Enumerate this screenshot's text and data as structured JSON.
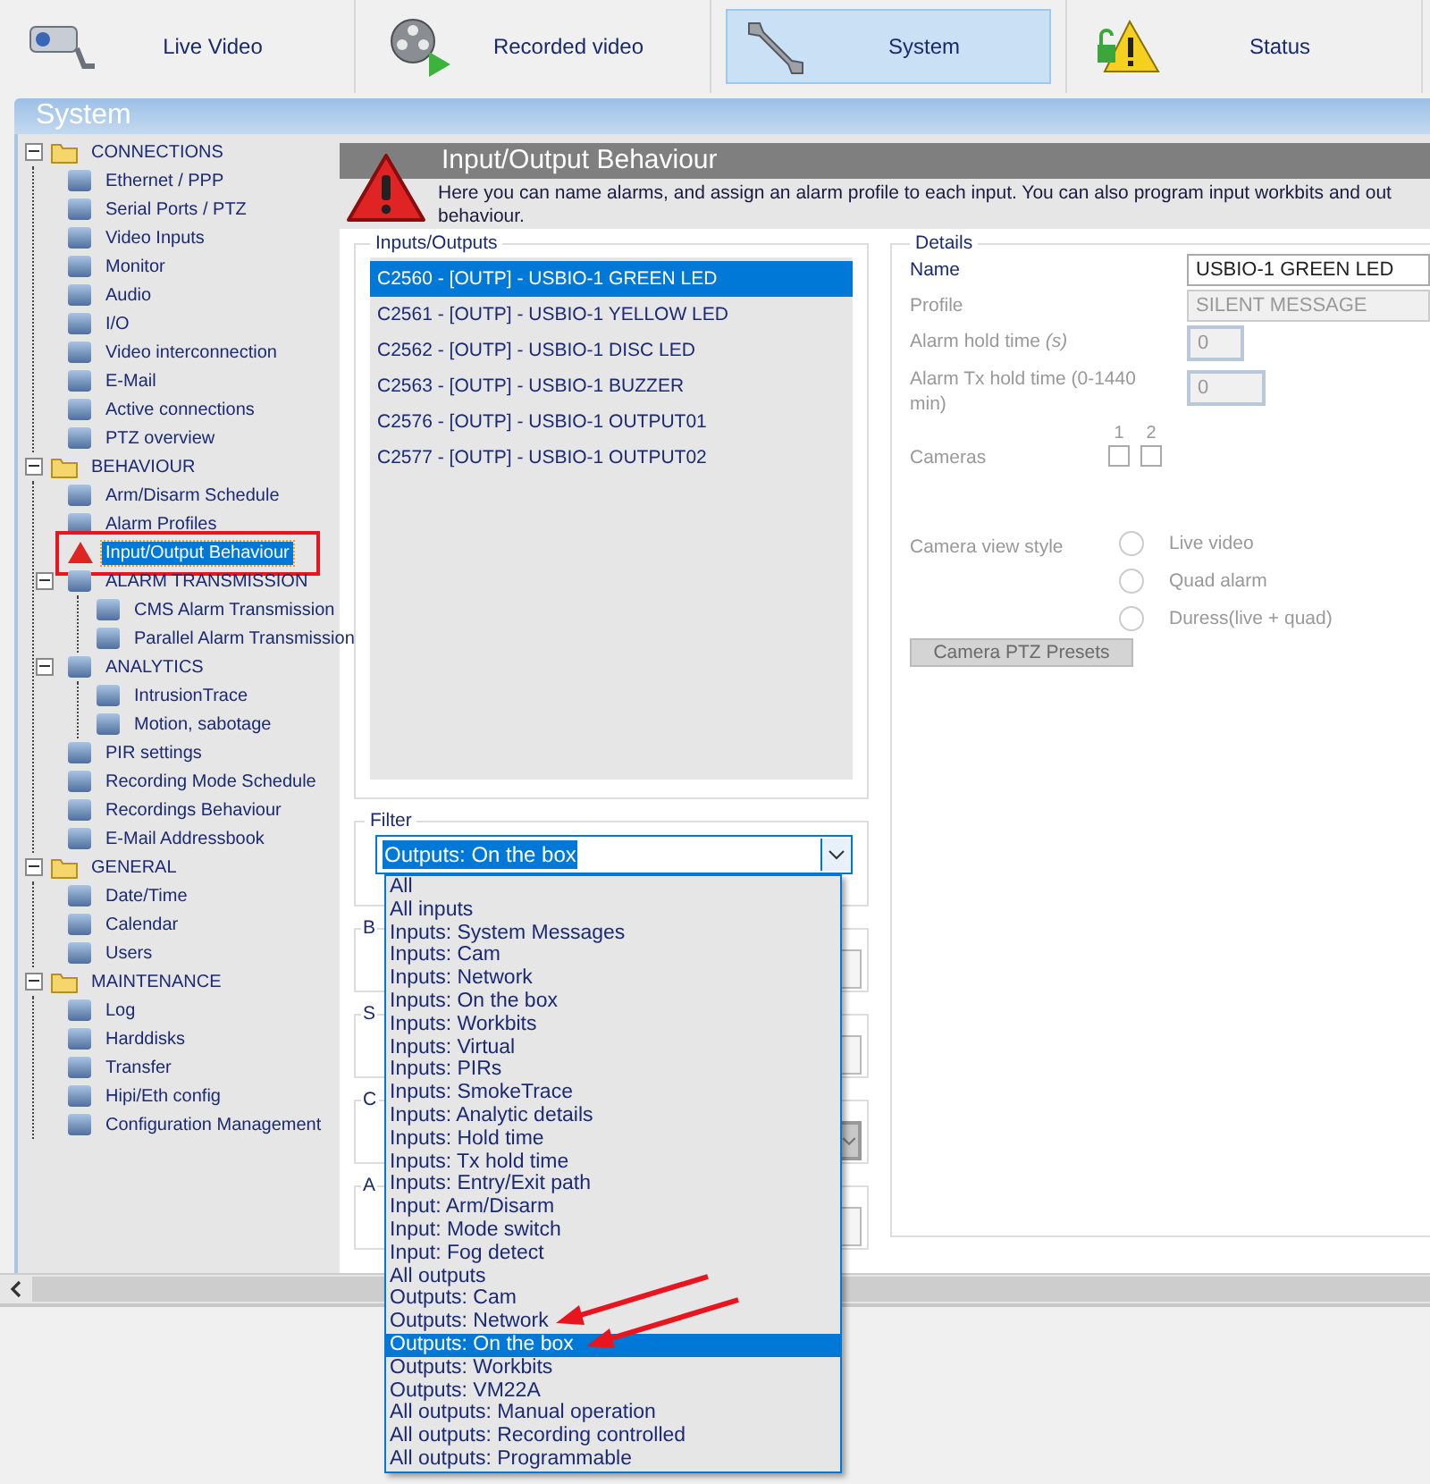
{
  "tabs": [
    {
      "label": "Live Video",
      "selected": false
    },
    {
      "label": "Recorded video",
      "selected": false
    },
    {
      "label": "System",
      "selected": true
    },
    {
      "label": "Status",
      "selected": false
    }
  ],
  "window": {
    "title": "System"
  },
  "sidebar": {
    "groups": [
      {
        "label": "CONNECTIONS",
        "expanded": true,
        "items": [
          {
            "label": "Ethernet / PPP",
            "selected": false
          },
          {
            "label": "Serial Ports / PTZ",
            "selected": false
          },
          {
            "label": "Video Inputs",
            "selected": false
          },
          {
            "label": "Monitor",
            "selected": false
          },
          {
            "label": "Audio",
            "selected": false
          },
          {
            "label": "I/O",
            "selected": false
          },
          {
            "label": "Video interconnection",
            "selected": false
          },
          {
            "label": "E-Mail",
            "selected": false
          },
          {
            "label": "Active connections",
            "selected": false
          },
          {
            "label": "PTZ overview",
            "selected": false
          }
        ]
      },
      {
        "label": "BEHAVIOUR",
        "expanded": true,
        "items": [
          {
            "label": "Arm/Disarm Schedule",
            "selected": false
          },
          {
            "label": "Alarm Profiles",
            "selected": false
          },
          {
            "label": "Input/Output Behaviour",
            "selected": true,
            "highlighted": true
          },
          {
            "label": "ALARM TRANSMISSION",
            "selected": false,
            "expanded": true,
            "children": [
              {
                "label": "CMS Alarm Transmission",
                "selected": false
              },
              {
                "label": "Parallel Alarm Transmission",
                "selected": false
              }
            ]
          },
          {
            "label": "ANALYTICS",
            "selected": false,
            "expanded": true,
            "children": [
              {
                "label": "IntrusionTrace",
                "selected": false
              },
              {
                "label": "Motion, sabotage",
                "selected": false
              }
            ]
          },
          {
            "label": "PIR settings",
            "selected": false
          },
          {
            "label": "Recording Mode Schedule",
            "selected": false
          },
          {
            "label": "Recordings Behaviour",
            "selected": false
          },
          {
            "label": "E-Mail Addressbook",
            "selected": false
          }
        ]
      },
      {
        "label": "GENERAL",
        "expanded": true,
        "items": [
          {
            "label": "Date/Time",
            "selected": false
          },
          {
            "label": "Calendar",
            "selected": false
          },
          {
            "label": "Users",
            "selected": false
          }
        ]
      },
      {
        "label": "MAINTENANCE",
        "expanded": true,
        "items": [
          {
            "label": "Log",
            "selected": false
          },
          {
            "label": "Harddisks",
            "selected": false
          },
          {
            "label": "Transfer",
            "selected": false
          },
          {
            "label": "Hipi/Eth config",
            "selected": false
          },
          {
            "label": "Configuration Management",
            "selected": false
          }
        ]
      }
    ]
  },
  "page": {
    "title": "Input/Output Behaviour",
    "description_lines": [
      "Here you can name alarms, and assign an alarm profile to each input. You can also program input workbits and out",
      "behaviour."
    ]
  },
  "inputs_outputs": {
    "legend": "Inputs/Outputs",
    "items": [
      {
        "label": "C2560 - [OUTP] - USBIO-1 GREEN LED",
        "selected": true
      },
      {
        "label": "C2561 - [OUTP] - USBIO-1 YELLOW LED",
        "selected": false
      },
      {
        "label": "C2562 - [OUTP] - USBIO-1 DISC LED",
        "selected": false
      },
      {
        "label": "C2563 - [OUTP] - USBIO-1 BUZZER",
        "selected": false
      },
      {
        "label": "C2576 - [OUTP] - USBIO-1 OUTPUT01",
        "selected": false
      },
      {
        "label": "C2577 - [OUTP] - USBIO-1 OUTPUT02",
        "selected": false
      }
    ]
  },
  "details": {
    "legend": "Details",
    "name": {
      "label": "Name",
      "value": "USBIO-1 GREEN LED",
      "disabled": false
    },
    "profile": {
      "label": "Profile",
      "value": "SILENT MESSAGE",
      "disabled": true
    },
    "alarm_hold": {
      "label": "Alarm hold time *(s)*",
      "value": "0",
      "disabled": true
    },
    "tx_hold": {
      "label": "Alarm Tx hold time (0-1440 min)",
      "value": "0",
      "disabled": true
    },
    "cameras": {
      "label": "Cameras",
      "disabled": true,
      "boxes": [
        {
          "number": "1",
          "checked": false
        },
        {
          "number": "2",
          "checked": false
        }
      ]
    },
    "view_style": {
      "label": "Camera view style",
      "disabled": true,
      "options": [
        {
          "label": "Live video",
          "selected": false
        },
        {
          "label": "Quad alarm",
          "selected": false
        },
        {
          "label": "Duress(live + quad)",
          "selected": false
        }
      ]
    },
    "ptz_button": {
      "label": "Camera PTZ Presets",
      "disabled": true
    }
  },
  "filter": {
    "legend": "Filter",
    "value": "Outputs: On the box",
    "open": true,
    "options": [
      {
        "label": "All",
        "selected": false,
        "arrow": false
      },
      {
        "label": "All inputs",
        "selected": false,
        "arrow": false
      },
      {
        "label": "Inputs: System Messages",
        "selected": false,
        "arrow": false
      },
      {
        "label": "Inputs: Cam",
        "selected": false,
        "arrow": false
      },
      {
        "label": "Inputs: Network",
        "selected": false,
        "arrow": false
      },
      {
        "label": "Inputs: On the box",
        "selected": false,
        "arrow": false
      },
      {
        "label": "Inputs: Workbits",
        "selected": false,
        "arrow": false
      },
      {
        "label": "Inputs: Virtual",
        "selected": false,
        "arrow": false
      },
      {
        "label": "Inputs: PIRs",
        "selected": false,
        "arrow": false
      },
      {
        "label": "Inputs: SmokeTrace",
        "selected": false,
        "arrow": false
      },
      {
        "label": "Inputs: Analytic details",
        "selected": false,
        "arrow": false
      },
      {
        "label": "Inputs: Hold time",
        "selected": false,
        "arrow": false
      },
      {
        "label": "Inputs: Tx hold time",
        "selected": false,
        "arrow": false
      },
      {
        "label": "Inputs: Entry/Exit path",
        "selected": false,
        "arrow": false
      },
      {
        "label": "Input: Arm/Disarm",
        "selected": false,
        "arrow": false
      },
      {
        "label": "Input: Mode switch",
        "selected": false,
        "arrow": false
      },
      {
        "label": "Input: Fog detect",
        "selected": false,
        "arrow": false
      },
      {
        "label": "All outputs",
        "selected": false,
        "arrow": false
      },
      {
        "label": "Outputs: Cam",
        "selected": false,
        "arrow": false
      },
      {
        "label": "Outputs: Network",
        "selected": false,
        "arrow": true
      },
      {
        "label": "Outputs: On the box",
        "selected": true,
        "arrow": true
      },
      {
        "label": "Outputs: Workbits",
        "selected": false,
        "arrow": false
      },
      {
        "label": "Outputs: VM22A",
        "selected": false,
        "arrow": false
      },
      {
        "label": "All outputs: Manual operation",
        "selected": false,
        "arrow": false
      },
      {
        "label": "All outputs: Recording controlled",
        "selected": false,
        "arrow": false
      },
      {
        "label": "All outputs: Programmable",
        "selected": false,
        "arrow": false
      }
    ]
  },
  "hidden_groups": [
    {
      "legend": "B",
      "kind": "field"
    },
    {
      "legend": "S",
      "kind": "field"
    },
    {
      "legend": "C",
      "kind": "select"
    },
    {
      "legend": "A",
      "kind": "field"
    }
  ]
}
